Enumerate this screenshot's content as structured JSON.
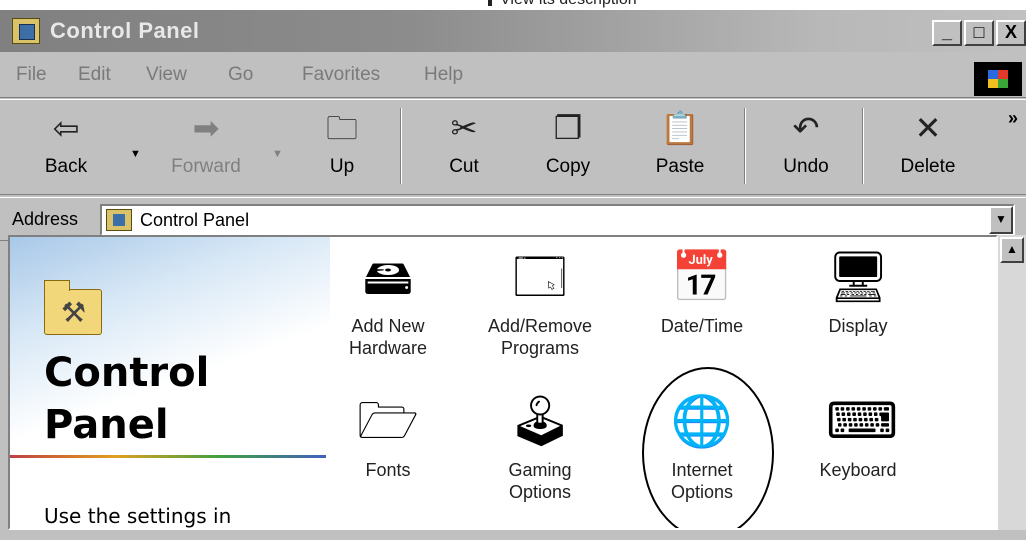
{
  "caption": "View its description",
  "window": {
    "title": "Control Panel",
    "buttons": {
      "minimize": "_",
      "maximize": "□",
      "close": "X"
    }
  },
  "menu": [
    {
      "label": "File"
    },
    {
      "label": "Edit"
    },
    {
      "label": "View"
    },
    {
      "label": "Go"
    },
    {
      "label": "Favorites"
    },
    {
      "label": "Help"
    }
  ],
  "toolbar": {
    "back": "Back",
    "forward": "Forward",
    "up": "Up",
    "cut": "Cut",
    "copy": "Copy",
    "paste": "Paste",
    "undo": "Undo",
    "delete": "Delete",
    "more": "»"
  },
  "address": {
    "label": "Address",
    "value": "Control Panel"
  },
  "left_pane": {
    "title_line1": "Control",
    "title_line2": "Panel",
    "description": "Use the settings in"
  },
  "applets": [
    {
      "line1": "Add New",
      "line2": "Hardware"
    },
    {
      "line1": "Add/Remove",
      "line2": "Programs"
    },
    {
      "line1": "Date/Time",
      "line2": ""
    },
    {
      "line1": "Display",
      "line2": ""
    },
    {
      "line1": "Fonts",
      "line2": ""
    },
    {
      "line1": "Gaming",
      "line2": "Options"
    },
    {
      "line1": "Internet",
      "line2": "Options"
    },
    {
      "line1": "Keyboard",
      "line2": ""
    }
  ],
  "highlighted_applet": "Internet Options"
}
